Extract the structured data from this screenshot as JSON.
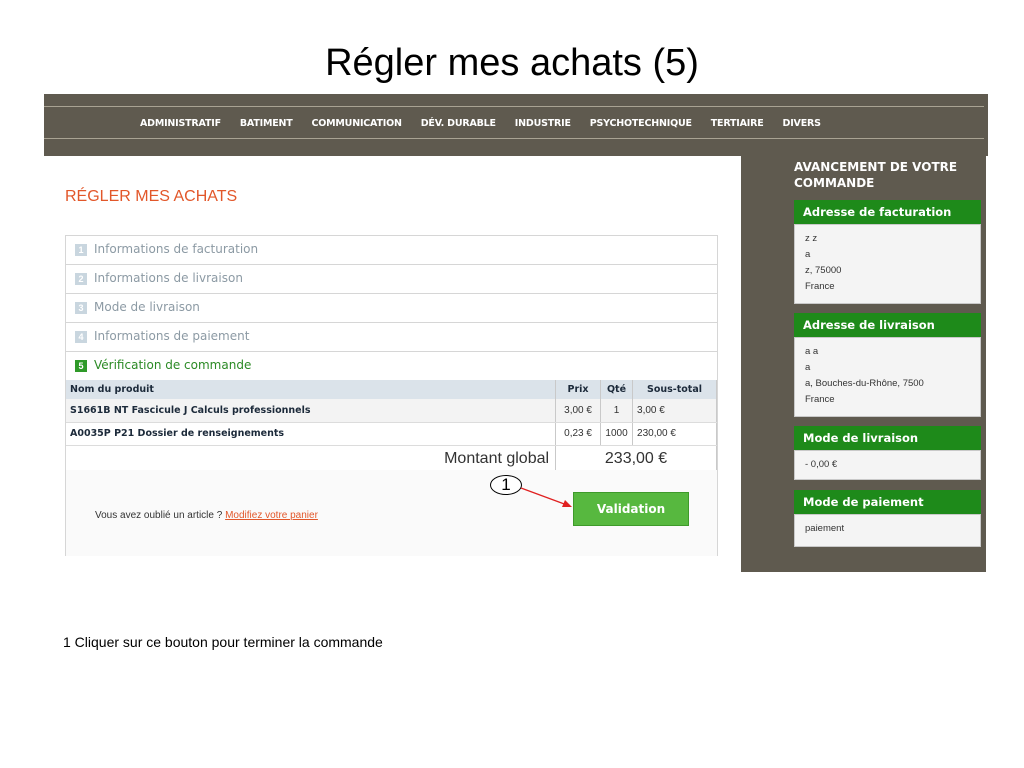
{
  "slide": {
    "title": "Régler mes achats (5)",
    "caption": "1 Cliquer sur ce bouton pour terminer la commande"
  },
  "nav": {
    "items": [
      "ADMINISTRATIF",
      "BATIMENT",
      "COMMUNICATION",
      "DÉV. DURABLE",
      "INDUSTRIE",
      "PSYCHOTECHNIQUE",
      "TERTIAIRE",
      "DIVERS"
    ]
  },
  "page": {
    "title": "RÉGLER MES ACHATS"
  },
  "steps": [
    {
      "num": "1",
      "label": "Informations de facturation"
    },
    {
      "num": "2",
      "label": "Informations de livraison"
    },
    {
      "num": "3",
      "label": "Mode de livraison"
    },
    {
      "num": "4",
      "label": "Informations de paiement"
    },
    {
      "num": "5",
      "label": "Vérification de commande"
    }
  ],
  "table": {
    "headers": {
      "product": "Nom du produit",
      "price": "Prix",
      "qty": "Qté",
      "subtotal": "Sous-total"
    },
    "rows": [
      {
        "product": "S1661B NT Fascicule J Calculs professionnels",
        "price": "3,00 €",
        "qty": "1",
        "subtotal": "3,00 €"
      },
      {
        "product": "A0035P P21 Dossier de renseignements",
        "price": "0,23 €",
        "qty": "1000",
        "subtotal": "230,00 €"
      }
    ],
    "total_label": "Montant global",
    "total_value": "233,00 €"
  },
  "footer": {
    "forgot_text": "Vous avez oublié un article ?",
    "forgot_link": "Modifiez votre panier",
    "validate_label": "Validation"
  },
  "annotation": {
    "marker": "1",
    "arrow_color": "#e02020"
  },
  "sidebar": {
    "title": "AVANCEMENT DE VOTRE COMMANDE",
    "billing": {
      "heading": "Adresse de facturation",
      "lines": [
        "z z",
        "a",
        "z, 75000",
        "France"
      ]
    },
    "shipping": {
      "heading": "Adresse de livraison",
      "lines": [
        "a a",
        "a",
        "a, Bouches-du-Rhône, 7500",
        "France"
      ]
    },
    "delivery": {
      "heading": "Mode de livraison",
      "lines": [
        "- 0,00 €"
      ]
    },
    "payment": {
      "heading": "Mode de paiement",
      "lines": [
        "paiement"
      ]
    }
  },
  "colors": {
    "accent_orange": "#e2572a",
    "green": "#1e8a1a",
    "nav_bg": "#5f5a4f"
  }
}
